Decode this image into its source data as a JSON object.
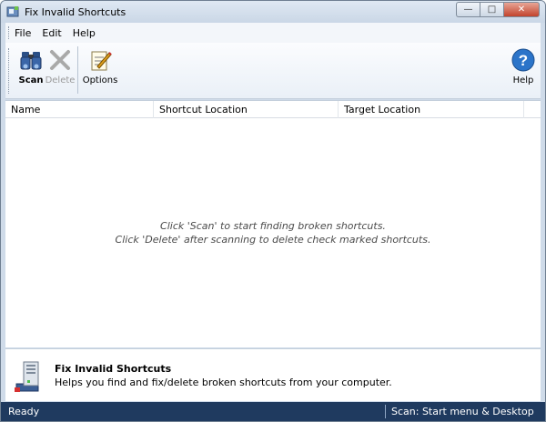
{
  "window": {
    "title": "Fix Invalid Shortcuts",
    "controls": {
      "minimize": "—",
      "maximize": "□",
      "close": "✕"
    }
  },
  "menu": {
    "items": [
      {
        "label": "File"
      },
      {
        "label": "Edit"
      },
      {
        "label": "Help"
      }
    ]
  },
  "toolbar": {
    "scan_label": "Scan",
    "delete_label": "Delete",
    "options_label": "Options",
    "help_label": "Help",
    "help_glyph": "?"
  },
  "list": {
    "columns": [
      "Name",
      "Shortcut Location",
      "Target Location"
    ],
    "empty_line1": "Click 'Scan' to start finding broken shortcuts.",
    "empty_line2": "Click 'Delete' after scanning to delete check marked shortcuts."
  },
  "description": {
    "title": "Fix Invalid Shortcuts",
    "text": "Helps you find and fix/delete broken shortcuts from your computer."
  },
  "status": {
    "left": "Ready",
    "right": "Scan: Start menu & Desktop"
  },
  "colors": {
    "statusbar": "#1f3a5f",
    "help_icon": "#2b74c9"
  }
}
